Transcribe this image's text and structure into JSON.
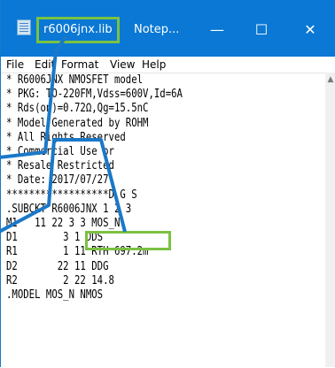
{
  "titlebar": {
    "file_name": "r6006jnx.lib",
    "app_name": "Notep...",
    "min_glyph": "—",
    "max_glyph": "☐",
    "close_glyph": "✕"
  },
  "menu": {
    "file": "File",
    "edit": "Edit",
    "format": "Format",
    "view": "View",
    "help": "Help"
  },
  "editor": {
    "lines": [
      "* R6006JNX NMOSFET model",
      "* PKG: TO-220FM,Vdss=600V,Id=6A",
      "* Rds(on)=0.72Ω,Qg=15.5nC",
      "* Model Generated by ROHM",
      "* All Rights Reserved",
      "* Commercial Use or",
      "* Resale Restricted",
      "* Date: 2017/07/27",
      "******************D G S",
      ".SUBCKT R6006JNX 1 2 3",
      "M1   11 22 3 3 MOS_N",
      "D1        3 1 DDS",
      "R1        1 11 RTH 697.2m",
      "D2       22 11 DDG",
      "R2        2 22 14.8",
      ".MODEL MOS_N NMOS"
    ]
  },
  "scrollbar": {
    "up_glyph": "▲"
  },
  "colors": {
    "titlebar": "#0a78d4",
    "highlight": "#7bc142",
    "pointer": "#1a78c8"
  }
}
